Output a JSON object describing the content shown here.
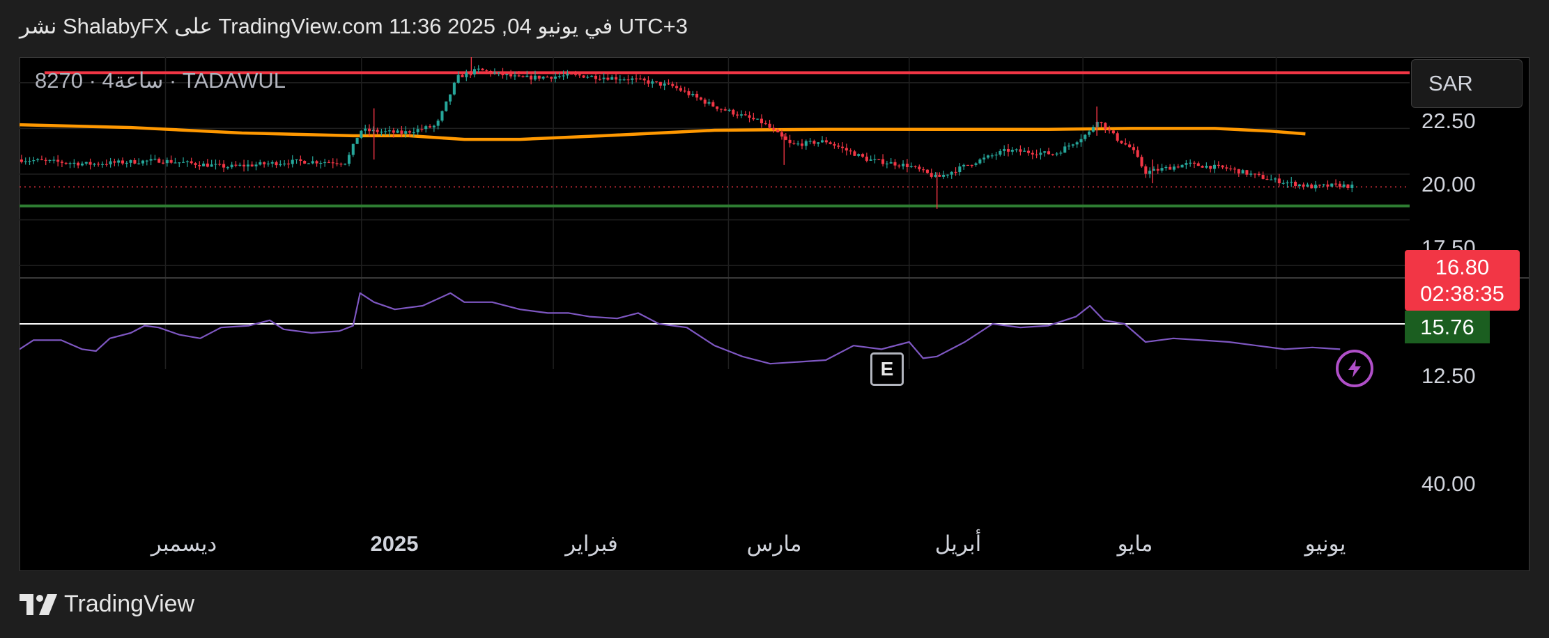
{
  "header": {
    "published_text": "نشر ShalabyFX على TradingView.com في يونيو 04, 2025 11:36 UTC+3"
  },
  "symbol_label": "8270 · 4ساعة · TADAWUL",
  "currency": "SAR",
  "edge_marker": "E",
  "footer": {
    "brand": "TradingView",
    "logo_icon": "tradingview-logo-icon"
  },
  "colors": {
    "up": "#26a69a",
    "down": "#f23645",
    "ma": "#ff9800",
    "resistance": "#f23645",
    "support": "#2e7d32",
    "rsi": "#7e57c2",
    "rsi_ref": "#ffffff",
    "last_price_tag": "#f23645",
    "support_tag": "#1b5e20",
    "bolt": "#b04fc8"
  },
  "chart_data": [
    {
      "type": "candlestick",
      "x_ticks": [
        {
          "label": "ديسمبر",
          "pos": 0.105,
          "bold": false
        },
        {
          "label": "2025",
          "pos": 0.246,
          "bold": true
        },
        {
          "label": "فبراير",
          "pos": 0.384,
          "bold": false
        },
        {
          "label": "مارس",
          "pos": 0.51,
          "bold": false
        },
        {
          "label": "أبريل",
          "pos": 0.64,
          "bold": false
        },
        {
          "label": "مايو",
          "pos": 0.765,
          "bold": false
        },
        {
          "label": "يونيو",
          "pos": 0.904,
          "bold": false
        }
      ],
      "y_ticks": [
        "22.50",
        "20.00",
        "17.50",
        "12.50"
      ],
      "ylim": [
        11.9,
        23.9
      ],
      "price_path": [
        [
          0,
          18.3
        ],
        [
          0.05,
          18.05
        ],
        [
          0.1,
          18.25
        ],
        [
          0.15,
          17.9
        ],
        [
          0.2,
          18.2
        ],
        [
          0.235,
          18.15
        ],
        [
          0.245,
          19.9
        ],
        [
          0.275,
          19.75
        ],
        [
          0.3,
          20.15
        ],
        [
          0.315,
          22.8
        ],
        [
          0.33,
          23.2
        ],
        [
          0.36,
          22.75
        ],
        [
          0.4,
          22.9
        ],
        [
          0.44,
          22.7
        ],
        [
          0.47,
          22.3
        ],
        [
          0.5,
          21.2
        ],
        [
          0.535,
          20.3
        ],
        [
          0.555,
          19.1
        ],
        [
          0.58,
          19.3
        ],
        [
          0.61,
          18.3
        ],
        [
          0.64,
          17.95
        ],
        [
          0.66,
          17.3
        ],
        [
          0.685,
          18.1
        ],
        [
          0.71,
          18.8
        ],
        [
          0.745,
          18.6
        ],
        [
          0.77,
          19.8
        ],
        [
          0.775,
          20.5
        ],
        [
          0.79,
          19.4
        ],
        [
          0.8,
          18.9
        ],
        [
          0.81,
          17.6
        ],
        [
          0.84,
          18.05
        ],
        [
          0.87,
          17.8
        ],
        [
          0.9,
          17.2
        ],
        [
          0.93,
          16.8
        ],
        [
          0.95,
          16.9
        ],
        [
          0.96,
          16.8
        ]
      ],
      "moving_average": [
        [
          0,
          20.2
        ],
        [
          0.08,
          20.05
        ],
        [
          0.16,
          19.75
        ],
        [
          0.24,
          19.6
        ],
        [
          0.28,
          19.6
        ],
        [
          0.32,
          19.4
        ],
        [
          0.36,
          19.4
        ],
        [
          0.42,
          19.6
        ],
        [
          0.5,
          19.9
        ],
        [
          0.58,
          19.95
        ],
        [
          0.66,
          19.95
        ],
        [
          0.74,
          19.95
        ],
        [
          0.8,
          20.0
        ],
        [
          0.86,
          20.0
        ],
        [
          0.9,
          19.85
        ],
        [
          0.925,
          19.7
        ]
      ],
      "resistance": 23.05,
      "support": 15.76,
      "last_price": "16.80",
      "countdown": "02:38:35",
      "support_label": "15.76"
    },
    {
      "type": "line",
      "name": "RSI",
      "y_ticks": [
        "40.00"
      ],
      "ylim": [
        25,
        75
      ],
      "reference_level": 50,
      "series": [
        {
          "values": [
            [
              0,
              36
            ],
            [
              0.01,
              41
            ],
            [
              0.03,
              41
            ],
            [
              0.045,
              36
            ],
            [
              0.055,
              35
            ],
            [
              0.065,
              42
            ],
            [
              0.08,
              45
            ],
            [
              0.09,
              49
            ],
            [
              0.1,
              48
            ],
            [
              0.115,
              44
            ],
            [
              0.13,
              42
            ],
            [
              0.145,
              48
            ],
            [
              0.165,
              49
            ],
            [
              0.18,
              52
            ],
            [
              0.19,
              47
            ],
            [
              0.21,
              45
            ],
            [
              0.23,
              46
            ],
            [
              0.24,
              49
            ],
            [
              0.245,
              67
            ],
            [
              0.255,
              62
            ],
            [
              0.27,
              58
            ],
            [
              0.29,
              60
            ],
            [
              0.31,
              67
            ],
            [
              0.32,
              62
            ],
            [
              0.34,
              62
            ],
            [
              0.36,
              58
            ],
            [
              0.38,
              56
            ],
            [
              0.395,
              56
            ],
            [
              0.41,
              54
            ],
            [
              0.43,
              53
            ],
            [
              0.445,
              56
            ],
            [
              0.46,
              50
            ],
            [
              0.48,
              48
            ],
            [
              0.5,
              38
            ],
            [
              0.52,
              32
            ],
            [
              0.54,
              28
            ],
            [
              0.56,
              29
            ],
            [
              0.58,
              30
            ],
            [
              0.6,
              38
            ],
            [
              0.62,
              36
            ],
            [
              0.64,
              40
            ],
            [
              0.65,
              31
            ],
            [
              0.66,
              32
            ],
            [
              0.68,
              40
            ],
            [
              0.7,
              50
            ],
            [
              0.72,
              48
            ],
            [
              0.74,
              49
            ],
            [
              0.76,
              54
            ],
            [
              0.77,
              60
            ],
            [
              0.78,
              52
            ],
            [
              0.795,
              50
            ],
            [
              0.81,
              40
            ],
            [
              0.83,
              42
            ],
            [
              0.85,
              41
            ],
            [
              0.87,
              40
            ],
            [
              0.89,
              38
            ],
            [
              0.91,
              36
            ],
            [
              0.93,
              37
            ],
            [
              0.95,
              36
            ]
          ]
        }
      ]
    }
  ]
}
